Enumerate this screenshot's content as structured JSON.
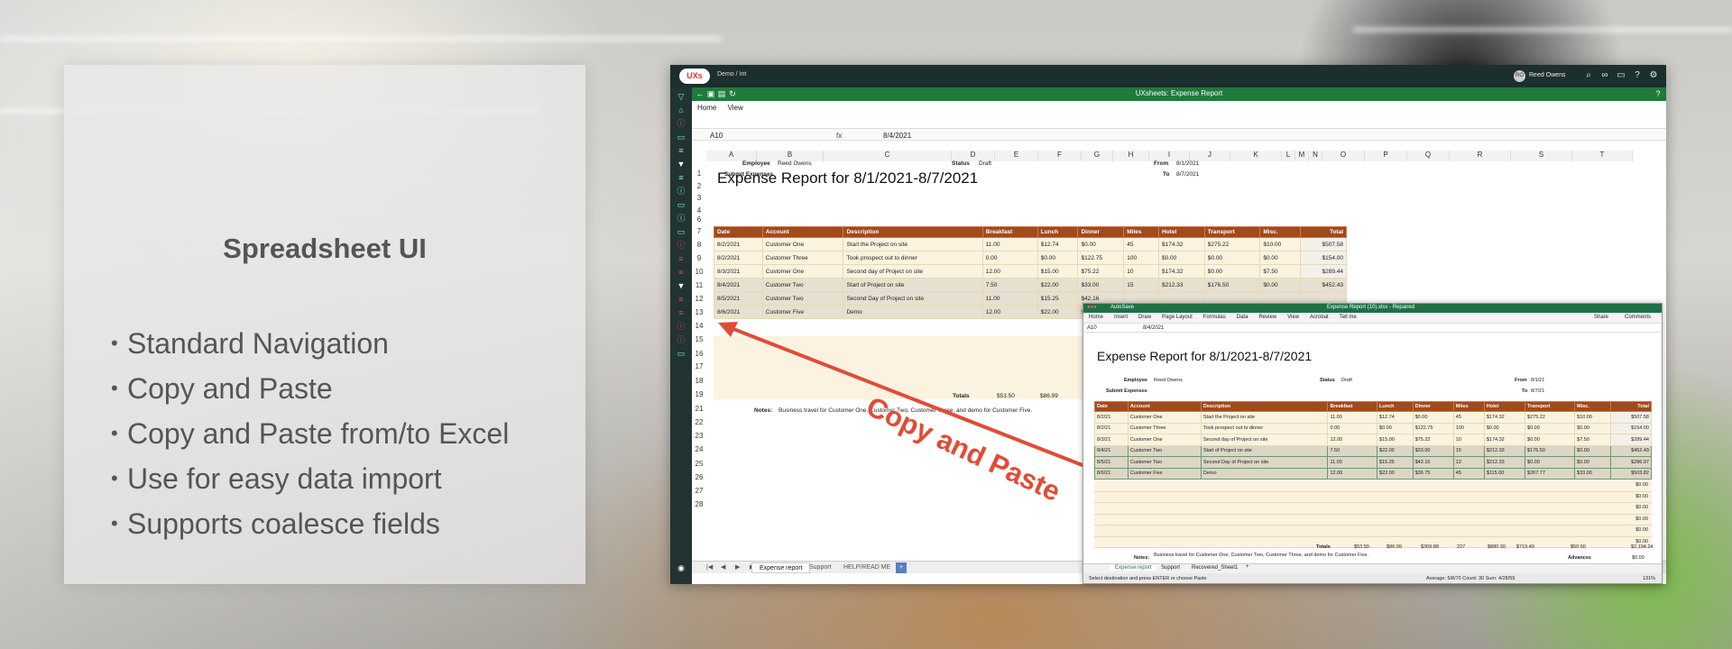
{
  "slide": {
    "title": "Spreadsheet UI",
    "bullets": [
      "Standard Navigation",
      "Copy and Paste",
      "Copy and Paste from/to Excel",
      "Use for easy data import",
      "Supports coalesce fields"
    ],
    "bullet_glyph": "•",
    "callout": "Copy and Paste"
  },
  "app": {
    "logo_text": "UXs",
    "breadcrumb": "Demo / Int",
    "user_initials": "RO",
    "user_name": "Reed Owens",
    "title": "UXsheets: Expense Report",
    "menu": [
      "Home",
      "View"
    ],
    "cell_ref": "A10",
    "fx": "fx",
    "formula_value": "8/4/2021",
    "columns": [
      "A",
      "B",
      "C",
      "D",
      "E",
      "F",
      "G",
      "H",
      "I",
      "J",
      "K",
      "L",
      "M",
      "N",
      "O",
      "P",
      "Q",
      "R",
      "S",
      "T"
    ],
    "rows": [
      "1",
      "2",
      "3",
      "4",
      "6",
      "7",
      "8",
      "9",
      "10",
      "11",
      "12",
      "13",
      "14",
      "15",
      "16",
      "17",
      "18",
      "19",
      "21",
      "22",
      "23",
      "24",
      "25",
      "26",
      "27",
      "28"
    ],
    "sheet": {
      "title": "Expense Report for 8/1/2021-8/7/2021",
      "employee_label": "Employee",
      "employee": "Reed Owens",
      "status_label": "Status",
      "status": "Draft",
      "from_label": "From",
      "from": "8/1/2021",
      "to_label": "To",
      "to": "8/7/2021",
      "submit": "Submit Expenses",
      "headers": [
        "Date",
        "Account",
        "Description",
        "Breakfast",
        "Lunch",
        "Dinner",
        "Miles",
        "Hotel",
        "Transport",
        "Misc.",
        "Total"
      ],
      "rows": [
        [
          "8/2/2021",
          "Customer One",
          "Start the Project on site",
          "11.00",
          "$12.74",
          "$0.00",
          "45",
          "$174.32",
          "$275.22",
          "$10.00",
          "$507.58"
        ],
        [
          "8/2/2021",
          "Customer Three",
          "Took prospect out to dinner",
          "0.00",
          "$0.00",
          "$122.75",
          "100",
          "$0.00",
          "$0.00",
          "$0.00",
          "$154.00"
        ],
        [
          "8/3/2021",
          "Customer One",
          "Second day of Project on site",
          "12.00",
          "$15.00",
          "$75.22",
          "10",
          "$174.32",
          "$0.00",
          "$7.50",
          "$289.44"
        ],
        [
          "8/4/2021",
          "Customer Two",
          "Start of Project on site",
          "7.50",
          "$22.00",
          "$33.00",
          "15",
          "$212.33",
          "$176.50",
          "$0.00",
          "$452.43"
        ],
        [
          "8/5/2021",
          "Customer Two",
          "Second Day of Project on site",
          "11.00",
          "$15.25",
          "$42.16",
          "",
          "",
          "",
          "",
          ""
        ],
        [
          "8/6/2021",
          "Customer Five",
          "Demo",
          "12.00",
          "$22.00",
          "$36.75",
          "",
          "",
          "",
          "",
          ""
        ]
      ],
      "totals_label": "Totals",
      "totals_partial": [
        "$53.50",
        "$86.99"
      ],
      "notes_label": "Notes:",
      "notes": "Business travel for Customer One, Customer Two, Customer Three, and demo for Customer Five."
    },
    "tabs": [
      "Expense report",
      "Support",
      "HELP/READ ME"
    ]
  },
  "excel": {
    "title": "Expense Report (10).xlsx - Repaired",
    "autosave": "AutoSave",
    "ribbon": [
      "Home",
      "Insert",
      "Draw",
      "Page Layout",
      "Formulas",
      "Data",
      "Review",
      "View",
      "Acrobat",
      "Tell me"
    ],
    "share": "Share",
    "comments": "Comments",
    "cell_ref": "A10",
    "formula_value": "8/4/2021",
    "sheet": {
      "title": "Expense Report for 8/1/2021-8/7/2021",
      "employee_label": "Employee",
      "employee": "Reed Owens",
      "status_label": "Status",
      "status": "Draft",
      "from_label": "From",
      "from": "8/1/21",
      "to_label": "To",
      "to": "8/7/21",
      "submit": "Submit Expenses",
      "headers": [
        "Date",
        "Account",
        "Description",
        "Breakfast",
        "Lunch",
        "Dinner",
        "Miles",
        "Hotel",
        "Transport",
        "Misc.",
        "Total"
      ],
      "rows": [
        [
          "8/2/21",
          "Customer One",
          "Start the Project on site",
          "11.00",
          "$12.74",
          "$0.00",
          "45",
          "$174.32",
          "$275.22",
          "$10.00",
          "$507.58"
        ],
        [
          "8/2/21",
          "Customer Three",
          "Took prospect out to dinner",
          "0.00",
          "$0.00",
          "$122.75",
          "100",
          "$0.00",
          "$0.00",
          "$0.00",
          "$154.00"
        ],
        [
          "8/3/21",
          "Customer One",
          "Second day of Project on site",
          "12.00",
          "$15.00",
          "$75.22",
          "10",
          "$174.32",
          "$0.00",
          "$7.50",
          "$289.44"
        ],
        [
          "8/4/21",
          "Customer Two",
          "Start of Project on site",
          "7.50",
          "$22.00",
          "$33.00",
          "15",
          "$212.33",
          "$176.50",
          "$0.00",
          "$452.43"
        ],
        [
          "8/5/21",
          "Customer Two",
          "Second Day of Project on site",
          "11.00",
          "$15.25",
          "$42.16",
          "12",
          "$212.33",
          "$0.00",
          "$0.00",
          "$286.97"
        ],
        [
          "8/6/21",
          "Customer Five",
          "Demo",
          "12.00",
          "$22.00",
          "$36.75",
          "45",
          "$115.00",
          "$267.77",
          "$33.00",
          "$503.82"
        ]
      ],
      "empty_totals": [
        "$0.00",
        "$0.00",
        "$0.00",
        "$0.00",
        "$0.00",
        "$0.00"
      ],
      "totals_label": "Totals",
      "totals": [
        "$53.50",
        "$86.99",
        "$309.88",
        "227",
        "$880.30",
        "$719.49",
        "$50.50",
        "$2,194.24"
      ],
      "notes_label": "Notes:",
      "notes": "Business travel for Customer One, Customer Two, Customer Three, and demo for Customer Five.",
      "advances_label": "Advances",
      "advances": "$0.00"
    },
    "tabs": [
      "Expense report",
      "Support",
      "Recovered_Sheet1"
    ],
    "status_left": "Select destination and press ENTER or choose Paste",
    "status_right": "Average: 5/8/70     Count: 30     Sum: 4/28/59",
    "zoom": "131%"
  }
}
